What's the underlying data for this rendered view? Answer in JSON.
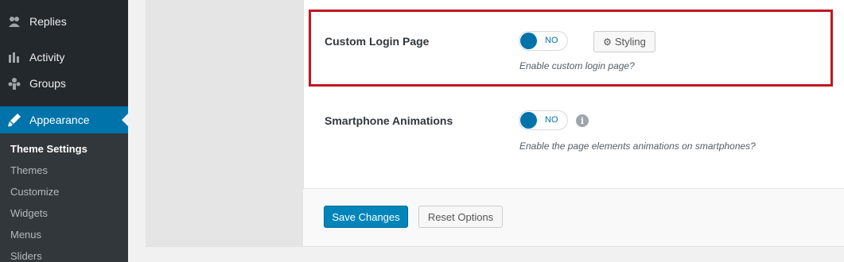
{
  "sidebar": {
    "items": [
      {
        "label": "Replies",
        "icon": "replies-icon"
      },
      {
        "label": "Activity",
        "icon": "activity-icon"
      },
      {
        "label": "Groups",
        "icon": "groups-icon"
      },
      {
        "label": "Appearance",
        "icon": "appearance-brush-icon"
      }
    ],
    "submenu": [
      "Theme Settings",
      "Themes",
      "Customize",
      "Widgets",
      "Menus",
      "Sliders"
    ]
  },
  "options": {
    "custom_login": {
      "label": "Custom Login Page",
      "toggle_state": "NO",
      "styling_button": "Styling",
      "description": "Enable custom login page?"
    },
    "smartphone_animations": {
      "label": "Smartphone Animations",
      "toggle_state": "NO",
      "info_icon": "i",
      "description": "Enable the page elements animations on smartphones?"
    }
  },
  "footer": {
    "save_label": "Save Changes",
    "reset_label": "Reset Options"
  },
  "colors": {
    "accent": "#0073aa",
    "highlight": "#c0171e"
  }
}
